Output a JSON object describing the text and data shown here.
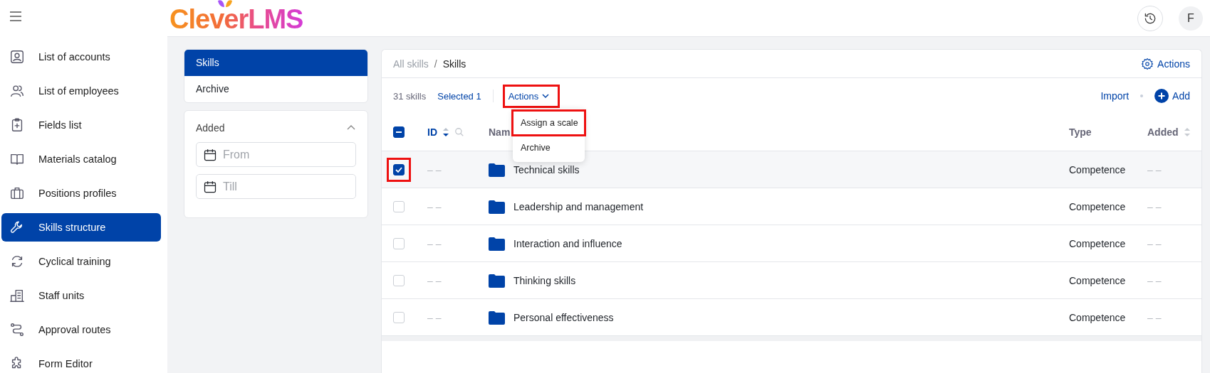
{
  "app": {
    "logo": "CleverLMS",
    "avatar": "F"
  },
  "sidebar": {
    "items": [
      {
        "label": "List of accounts",
        "selected": false
      },
      {
        "label": "List of employees",
        "selected": false
      },
      {
        "label": "Fields list",
        "selected": false
      },
      {
        "label": "Materials catalog",
        "selected": false
      },
      {
        "label": "Positions profiles",
        "selected": false
      },
      {
        "label": "Skills structure",
        "selected": true
      },
      {
        "label": "Cyclical training",
        "selected": false
      },
      {
        "label": "Staff units",
        "selected": false
      },
      {
        "label": "Approval routes",
        "selected": false
      },
      {
        "label": "Form Editor",
        "selected": false
      }
    ]
  },
  "filter": {
    "tabs": [
      {
        "label": "Skills",
        "selected": true
      },
      {
        "label": "Archive",
        "selected": false
      }
    ],
    "section": {
      "title": "Added",
      "expanded": true,
      "fields": [
        {
          "placeholder": "From"
        },
        {
          "placeholder": "Till"
        }
      ]
    }
  },
  "main": {
    "breadcrumb": [
      {
        "label": "All skills",
        "current": false
      },
      {
        "label": "Skills",
        "current": true
      }
    ],
    "separator": "/",
    "header_action": "Actions",
    "count": "31 skills",
    "selected_count": "Selected 1",
    "actions_menu": {
      "label": "Actions",
      "highlighted": true,
      "expanded": true,
      "items": [
        {
          "label": "Assign a scale",
          "highlighted": true
        },
        {
          "label": "Archive",
          "highlighted": false
        }
      ]
    },
    "import": "Import",
    "add": "Add",
    "table": {
      "select_all": {
        "checked": true,
        "partial": true
      },
      "columns": [
        {
          "label": "ID",
          "sortable": true,
          "sorted": true,
          "search": true
        },
        {
          "label": "Nam",
          "sortable": false,
          "sorted": false,
          "search": false
        },
        {
          "label": "Type",
          "sortable": false,
          "sorted": false,
          "search": false
        },
        {
          "label": "Added",
          "sortable": true,
          "sorted": false,
          "search": false
        }
      ],
      "rows": [
        {
          "id": "– –",
          "name": "Technical skills",
          "type": "Competence",
          "added": "– –",
          "checked": true,
          "highlighted": true
        },
        {
          "id": "– –",
          "name": "Leadership and management",
          "type": "Competence",
          "added": "– –",
          "checked": false,
          "highlighted": false
        },
        {
          "id": "– –",
          "name": "Interaction and influence",
          "type": "Competence",
          "added": "– –",
          "checked": false,
          "highlighted": false
        },
        {
          "id": "– –",
          "name": "Thinking skills",
          "type": "Competence",
          "added": "– –",
          "checked": false,
          "highlighted": false
        },
        {
          "id": "– –",
          "name": "Personal effectiveness",
          "type": "Competence",
          "added": "– –",
          "checked": false,
          "highlighted": false
        }
      ]
    }
  }
}
